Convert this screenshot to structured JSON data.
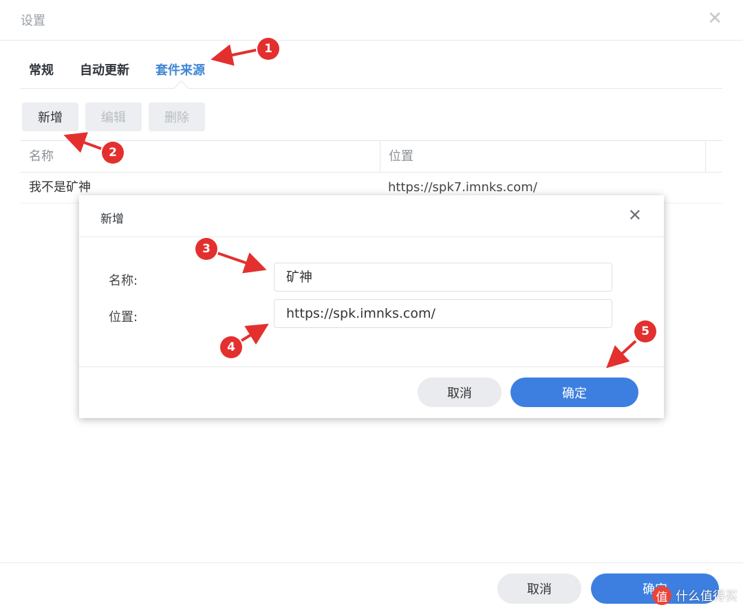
{
  "window": {
    "title": "设置"
  },
  "tabs": [
    {
      "label": "常规",
      "active": false
    },
    {
      "label": "自动更新",
      "active": false
    },
    {
      "label": "套件来源",
      "active": true
    }
  ],
  "toolbar": {
    "add_label": "新增",
    "edit_label": "编辑",
    "delete_label": "删除"
  },
  "grid": {
    "columns": [
      "名称",
      "位置"
    ],
    "rows": [
      {
        "name": "我不是矿神",
        "location": "https://spk7.imnks.com/"
      }
    ]
  },
  "footer": {
    "cancel_label": "取消",
    "ok_label": "确定"
  },
  "watermark": {
    "logo": "值",
    "text": "什么值得买"
  },
  "modal": {
    "title": "新增",
    "name_label": "名称:",
    "name_value": "矿神",
    "location_label": "位置:",
    "location_value": "https://spk.imnks.com/",
    "cancel_label": "取消",
    "ok_label": "确定"
  },
  "callouts": [
    "1",
    "2",
    "3",
    "4",
    "5"
  ],
  "colors": {
    "accent": "#3d7fe0",
    "callout": "#e3302f",
    "active_tab": "#3f86d4"
  }
}
